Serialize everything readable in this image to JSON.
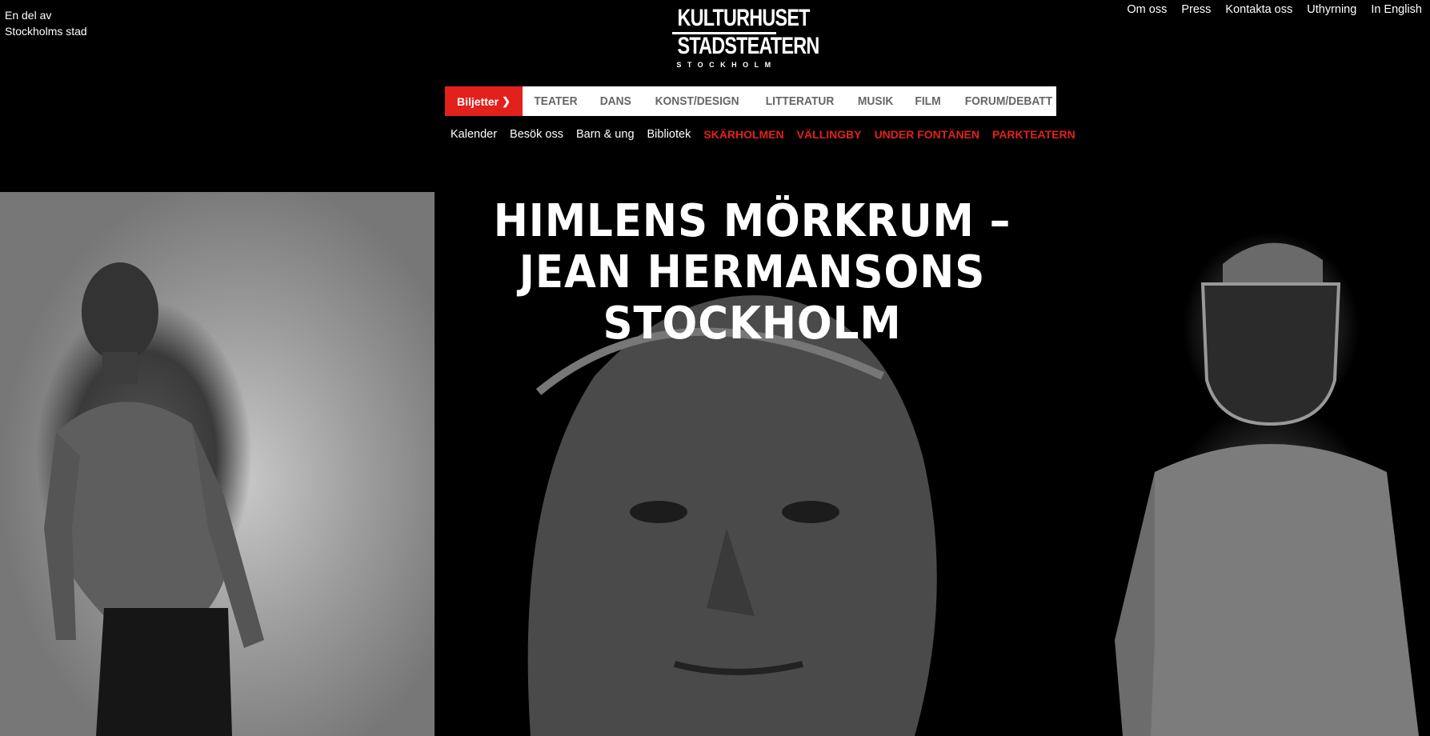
{
  "header": {
    "parent_line1": "En del av",
    "parent_line2": "Stockholms stad",
    "logo": {
      "line1": "KULTURHUSET",
      "line2": "STADSTEATERN",
      "line3": "STOCKHOLM"
    }
  },
  "utility_nav": [
    "Om oss",
    "Press",
    "Kontakta oss",
    "Uthyrning",
    "In English"
  ],
  "main_nav": {
    "tickets_label": "Biljetter",
    "tickets_color": "#e2211c",
    "categories": [
      "TEATER",
      "DANS",
      "KONST/DESIGN",
      "LITTERATUR",
      "MUSIK",
      "FILM",
      "FORUM/DEBATT"
    ]
  },
  "sub_nav": {
    "links": [
      "Kalender",
      "Besök oss",
      "Barn & ung",
      "Bibliotek"
    ],
    "venues": [
      "SKÄRHOLMEN",
      "VÄLLINGBY",
      "UNDER FONTÄNEN",
      "PARKTEATERN"
    ]
  },
  "hero": {
    "title_line1": "HIMLENS MÖRKRUM –",
    "title_line2": "JEAN HERMANSONS",
    "title_line3": "STOCKHOLM"
  }
}
